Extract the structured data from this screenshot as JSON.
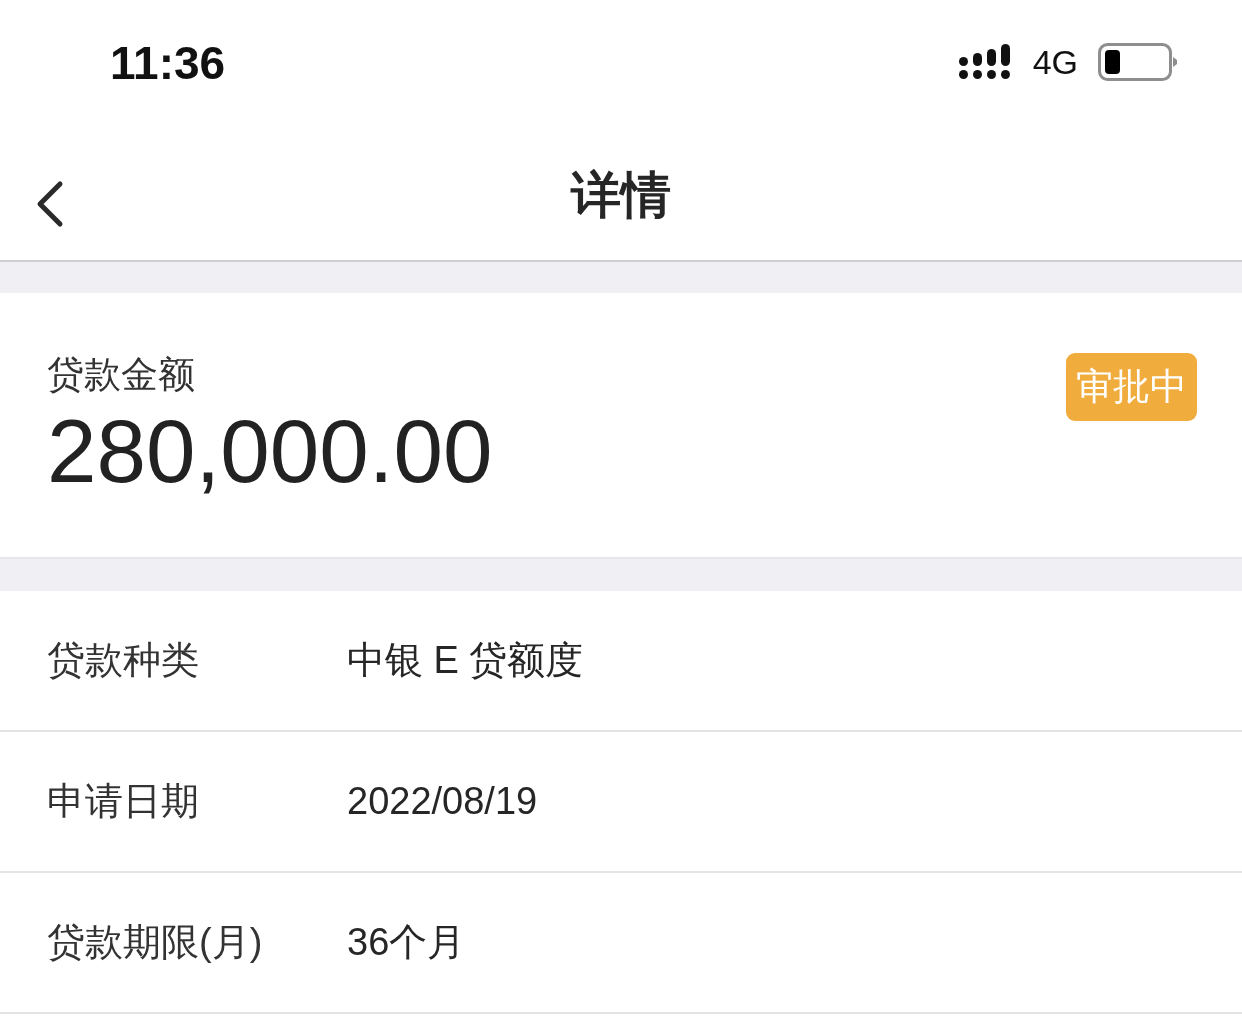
{
  "status_bar": {
    "time": "11:36",
    "network": "4G"
  },
  "nav_bar": {
    "title": "详情"
  },
  "amount_card": {
    "label": "贷款金额",
    "amount": "280,000.00",
    "status": "审批中"
  },
  "details": [
    {
      "label": "贷款种类",
      "value": "中银 E 贷额度"
    },
    {
      "label": "申请日期",
      "value": "2022/08/19"
    },
    {
      "label": "贷款期限(月)",
      "value": "36个月"
    }
  ]
}
